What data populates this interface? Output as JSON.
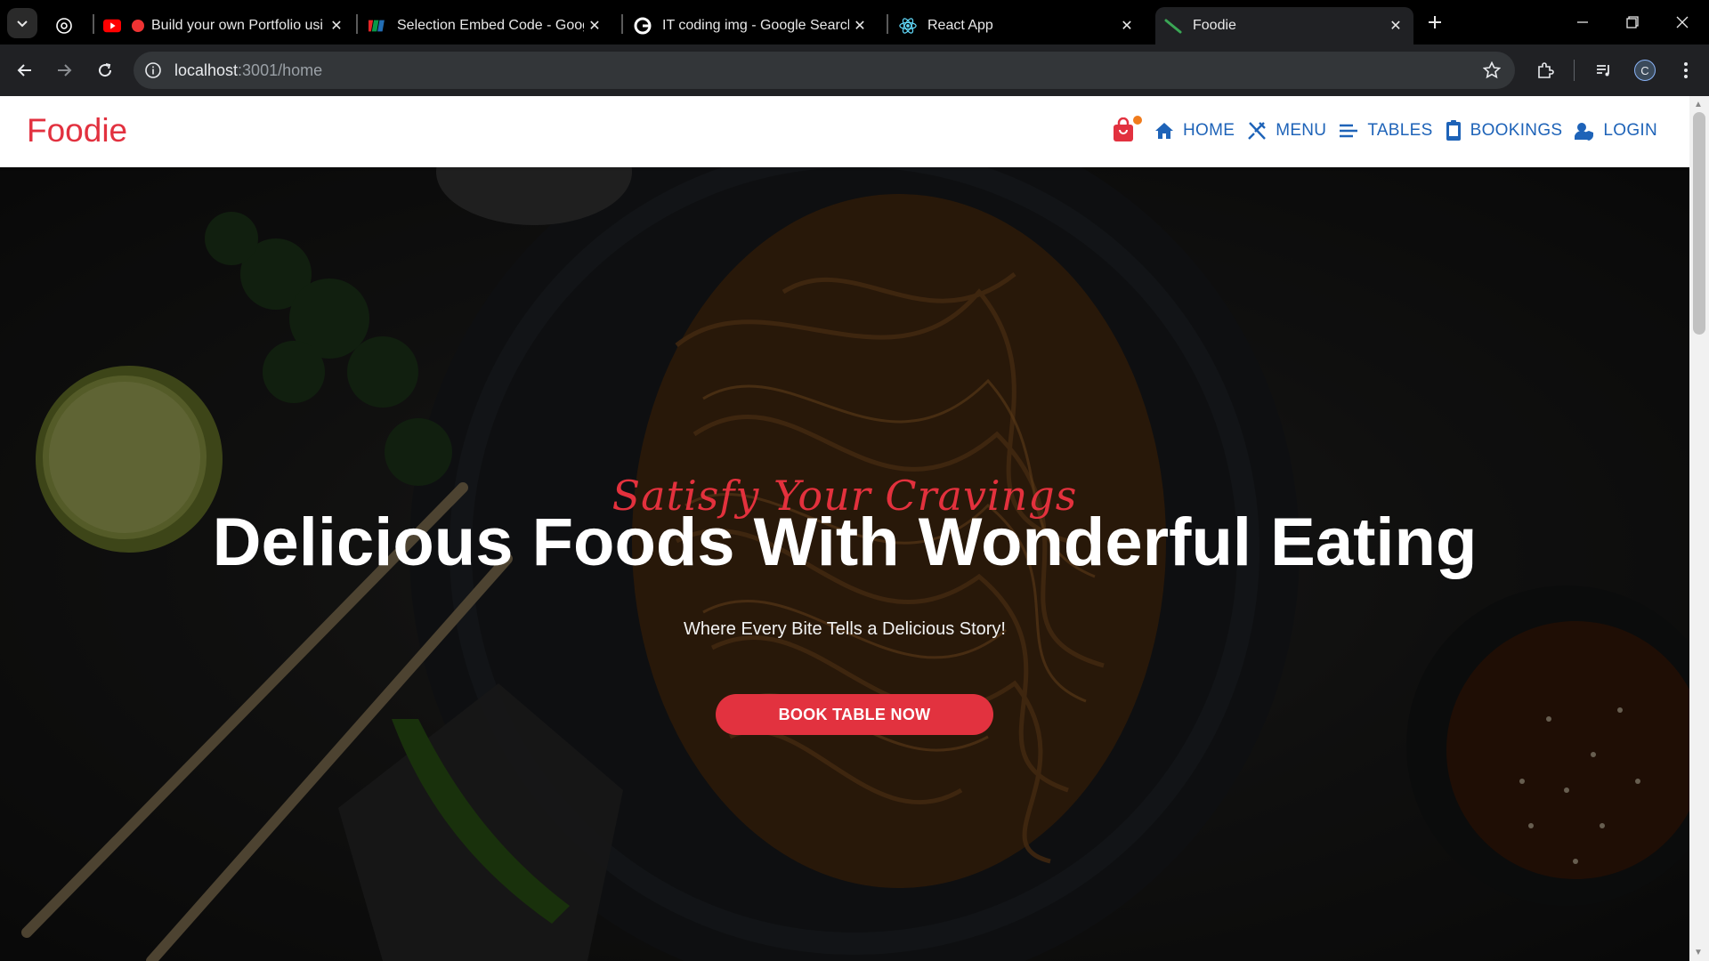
{
  "browser": {
    "tabs": [
      {
        "title": "",
        "icon": "chatgpt-icon"
      },
      {
        "title": "Build your own Portfolio usi",
        "icon": "youtube-icon",
        "recording": true
      },
      {
        "title": "Selection Embed Code - Googl",
        "icon": "zoho-icon"
      },
      {
        "title": "IT coding img - Google Search",
        "icon": "google-icon"
      },
      {
        "title": "React App",
        "icon": "react-icon"
      },
      {
        "title": "Foodie",
        "icon": "foodie-icon",
        "active": true
      }
    ],
    "url_host": "localhost",
    "url_path": ":3001/home",
    "profile_initial": "C"
  },
  "site": {
    "brand": "Foodie",
    "brand_color": "#e2313f",
    "nav_color": "#1e63b8",
    "nav": [
      {
        "label": "HOME",
        "icon": "home-icon"
      },
      {
        "label": "MENU",
        "icon": "utensils-icon"
      },
      {
        "label": "TABLES",
        "icon": "list-icon"
      },
      {
        "label": "BOOKINGS",
        "icon": "clipboard-icon"
      },
      {
        "label": "LOGIN",
        "icon": "user-shield-icon"
      }
    ],
    "cart_icon": "shopping-bag-icon"
  },
  "hero": {
    "tagline": "Satisfy Your Cravings",
    "headline": "Delicious Foods With Wonderful Eating",
    "subline": "Where Every Bite Tells a Delicious Story!",
    "cta_label": "BOOK TABLE NOW",
    "accent": "#e2323f"
  }
}
